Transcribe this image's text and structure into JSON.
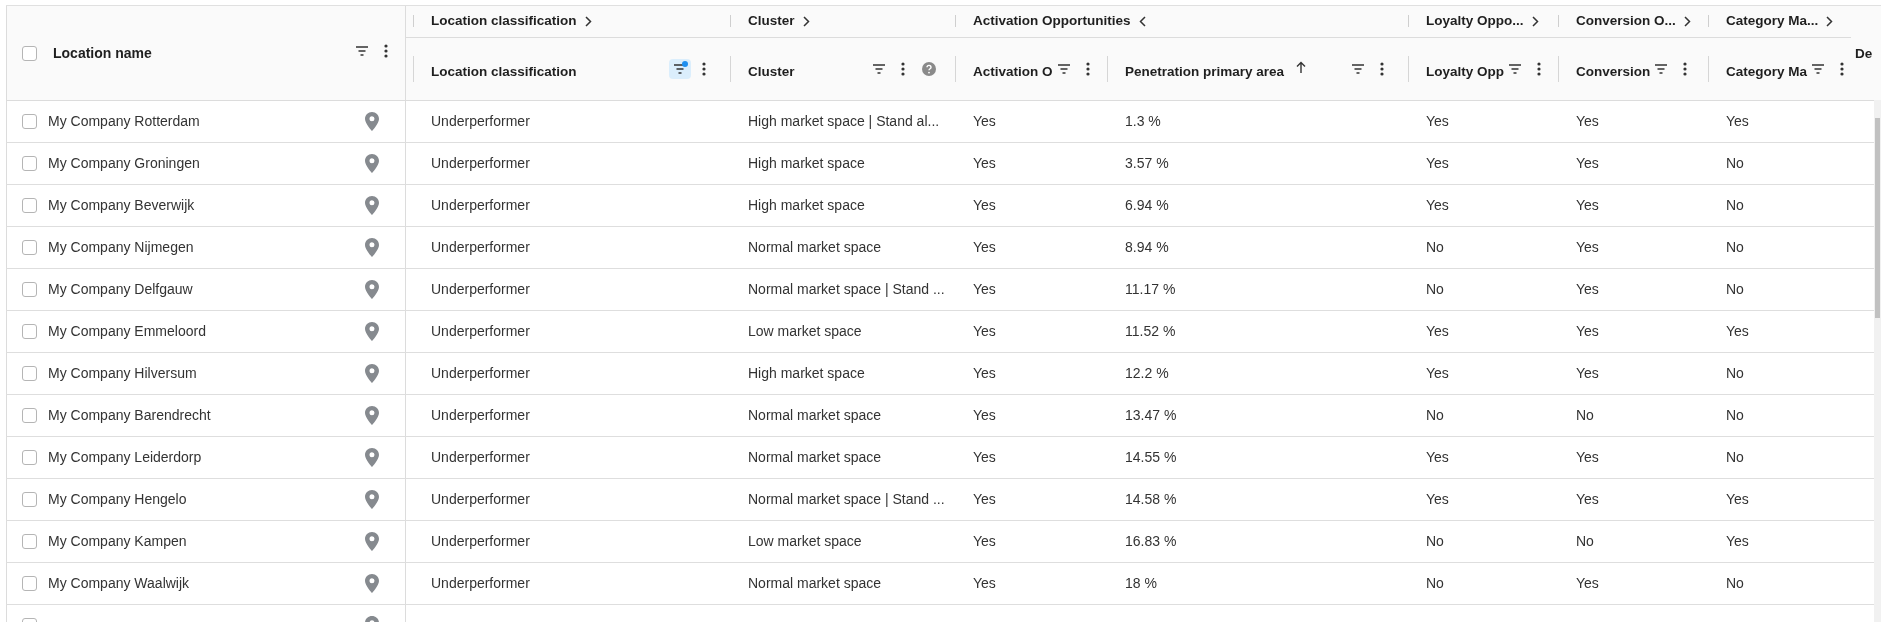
{
  "table": {
    "header_checkbox": {
      "checked": false
    },
    "name_column": {
      "label": "Location name"
    },
    "column_groups": [
      {
        "label": "Location classification",
        "expanded": false,
        "columns": [
          {
            "label": "Location classification",
            "filtered": true,
            "sorted": false
          }
        ]
      },
      {
        "label": "Cluster",
        "expanded": false,
        "columns": [
          {
            "label": "Cluster",
            "filtered": false,
            "sorted": false,
            "help": true
          }
        ]
      },
      {
        "label": "Activation Opportunities",
        "expanded": true,
        "columns": [
          {
            "label": "Activation O",
            "filtered": false,
            "sorted": false
          },
          {
            "label": "Penetration primary area",
            "filtered": false,
            "sorted": true
          }
        ]
      },
      {
        "label": "Loyalty Oppo...",
        "expanded": false,
        "columns": [
          {
            "label": "Loyalty Opp",
            "filtered": false,
            "sorted": false
          }
        ]
      },
      {
        "label": "Conversion O...",
        "expanded": false,
        "columns": [
          {
            "label": "Conversion",
            "filtered": false,
            "sorted": false
          }
        ]
      },
      {
        "label": "Category Ma...",
        "expanded": false,
        "columns": [
          {
            "label": "Category Ma",
            "filtered": false,
            "sorted": false
          }
        ]
      }
    ],
    "partial_column": {
      "label": "De"
    },
    "rows": [
      {
        "kind": "row",
        "checked": false,
        "name": "My Company Rotterdam",
        "cells": [
          "Underperformer",
          "High market space | Stand al...",
          "Yes",
          "1.3 %",
          "Yes",
          "Yes",
          "Yes"
        ]
      },
      {
        "kind": "row",
        "checked": false,
        "name": "My Company Groningen",
        "cells": [
          "Underperformer",
          "High market space",
          "Yes",
          "3.57 %",
          "Yes",
          "Yes",
          "No"
        ]
      },
      {
        "kind": "row",
        "checked": false,
        "name": "My Company Beverwijk",
        "cells": [
          "Underperformer",
          "High market space",
          "Yes",
          "6.94 %",
          "Yes",
          "Yes",
          "No"
        ]
      },
      {
        "kind": "row",
        "checked": false,
        "name": "My Company Nijmegen",
        "cells": [
          "Underperformer",
          "Normal market space",
          "Yes",
          "8.94 %",
          "No",
          "Yes",
          "No"
        ]
      },
      {
        "kind": "row",
        "checked": false,
        "name": "My Company Delfgauw",
        "cells": [
          "Underperformer",
          "Normal market space | Stand ...",
          "Yes",
          "11.17 %",
          "No",
          "Yes",
          "No"
        ]
      },
      {
        "kind": "row",
        "checked": false,
        "name": "My Company Emmeloord",
        "cells": [
          "Underperformer",
          "Low market space",
          "Yes",
          "11.52 %",
          "Yes",
          "Yes",
          "Yes"
        ]
      },
      {
        "kind": "row",
        "checked": false,
        "name": "My Company Hilversum",
        "cells": [
          "Underperformer",
          "High market space",
          "Yes",
          "12.2 %",
          "Yes",
          "Yes",
          "No"
        ]
      },
      {
        "kind": "row",
        "checked": false,
        "name": "My Company Barendrecht",
        "cells": [
          "Underperformer",
          "Normal market space",
          "Yes",
          "13.47 %",
          "No",
          "No",
          "No"
        ]
      },
      {
        "kind": "row",
        "checked": false,
        "name": "My Company Leiderdorp",
        "cells": [
          "Underperformer",
          "Normal market space",
          "Yes",
          "14.55 %",
          "Yes",
          "Yes",
          "No"
        ]
      },
      {
        "kind": "row",
        "checked": false,
        "name": "My Company Hengelo",
        "cells": [
          "Underperformer",
          "Normal market space | Stand ...",
          "Yes",
          "14.58 %",
          "Yes",
          "Yes",
          "Yes"
        ]
      },
      {
        "kind": "row",
        "checked": false,
        "name": "My Company Kampen",
        "cells": [
          "Underperformer",
          "Low market space",
          "Yes",
          "16.83 %",
          "No",
          "No",
          "Yes"
        ]
      },
      {
        "kind": "row",
        "checked": false,
        "name": "My Company Waalwijk",
        "cells": [
          "Underperformer",
          "Normal market space",
          "Yes",
          "18 %",
          "No",
          "Yes",
          "No"
        ]
      },
      {
        "kind": "partial",
        "checked": false
      }
    ]
  }
}
